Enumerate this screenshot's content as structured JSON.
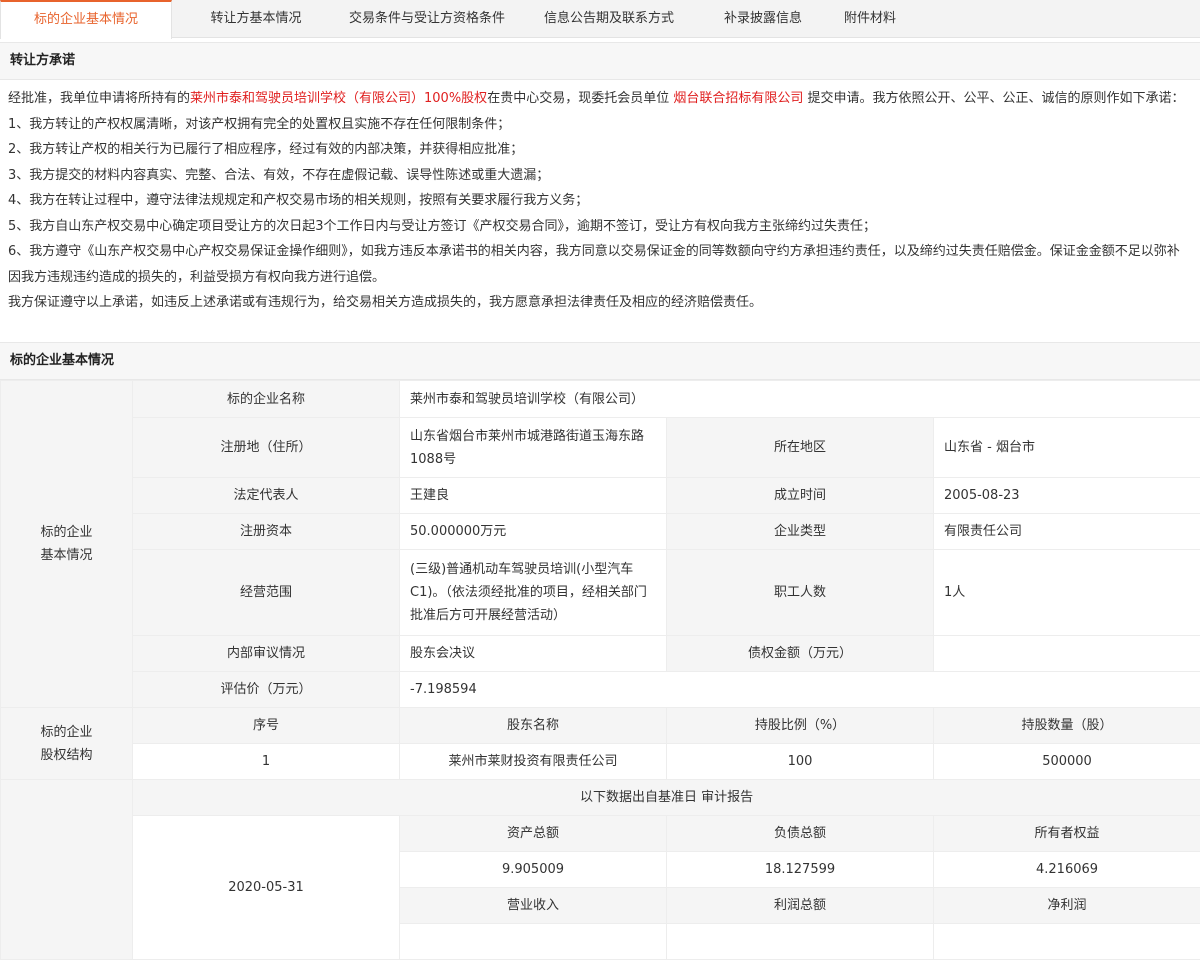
{
  "tabs": [
    {
      "label": "标的企业基本情况",
      "active": true
    },
    {
      "label": "转让方基本情况"
    },
    {
      "label": "交易条件与受让方资格条件"
    },
    {
      "label": "信息公告期及联系方式"
    },
    {
      "label": "补录披露信息"
    },
    {
      "label": "附件材料"
    }
  ],
  "commitment": {
    "heading": "转让方承诺",
    "intro_a": "经批准，我单位申请将所持有的",
    "asset": "莱州市泰和驾驶员培训学校（有限公司）100%股权",
    "intro_b": "在贵中心交易，现委托会员单位 ",
    "member": "烟台联合招标有限公司",
    "intro_c": " 提交申请。我方依照公开、公平、公正、诚信的原则作如下承诺：",
    "items": [
      "1、我方转让的产权权属清晰，对该产权拥有完全的处置权且实施不存在任何限制条件；",
      "2、我方转让产权的相关行为已履行了相应程序，经过有效的内部决策，并获得相应批准；",
      "3、我方提交的材料内容真实、完整、合法、有效，不存在虚假记载、误导性陈述或重大遗漏；",
      "4、我方在转让过程中，遵守法律法规规定和产权交易市场的相关规则，按照有关要求履行我方义务；",
      "5、我方自山东产权交易中心确定项目受让方的次日起3个工作日内与受让方签订《产权交易合同》，逾期不签订，受让方有权向我方主张缔约过失责任；",
      "6、我方遵守《山东产权交易中心产权交易保证金操作细则》，如我方违反本承诺书的相关内容，我方同意以交易保证金的同等数额向守约方承担违约责任，以及缔约过失责任赔偿金。保证金金额不足以弥补因我方违规违约造成的损失的，利益受损方有权向我方进行追偿。"
    ],
    "closing": "我方保证遵守以上承诺，如违反上述承诺或有违规行为，给交易相关方造成损失的，我方愿意承担法律责任及相应的经济赔偿责任。"
  },
  "enterprise": {
    "heading": "标的企业基本情况",
    "side_label": "标的企业基本情况",
    "name_label": "标的企业名称",
    "name": "莱州市泰和驾驶员培训学校（有限公司）",
    "address_label": "注册地（住所）",
    "address": "山东省烟台市莱州市城港路街道玉海东路1088号",
    "region_label": "所在地区",
    "region": "山东省 - 烟台市",
    "legal_rep_label": "法定代表人",
    "legal_rep": "王建良",
    "founded_label": "成立时间",
    "founded": "2005-08-23",
    "capital_label": "注册资本",
    "capital": "50.000000万元",
    "type_label": "企业类型",
    "type": "有限责任公司",
    "scope_label": "经营范围",
    "scope": "(三级)普通机动车驾驶员培训(小型汽车C1)。（依法须经批准的项目，经相关部门批准后方可开展经营活动）",
    "staff_label": "职工人数",
    "staff": "1人",
    "audit_label": "内部审议情况",
    "audit": "股东会决议",
    "debt_label": "债权金额（万元）",
    "debt": "",
    "valuation_label": "评估价（万元）",
    "valuation": "-7.198594"
  },
  "equity": {
    "side_label": "标的企业股权结构",
    "headers": [
      "序号",
      "股东名称",
      "持股比例（%）",
      "持股数量（股）"
    ],
    "rows": [
      [
        "1",
        "莱州市莱财投资有限责任公司",
        "100",
        "500000"
      ]
    ]
  },
  "finance": {
    "note": "以下数据出自基准日 审计报告",
    "date": "2020-05-31",
    "headers1": [
      "资产总额",
      "负债总额",
      "所有者权益"
    ],
    "values1": [
      "9.905009",
      "18.127599",
      "4.216069"
    ],
    "headers2": [
      "营业收入",
      "利润总额",
      "净利润"
    ]
  }
}
